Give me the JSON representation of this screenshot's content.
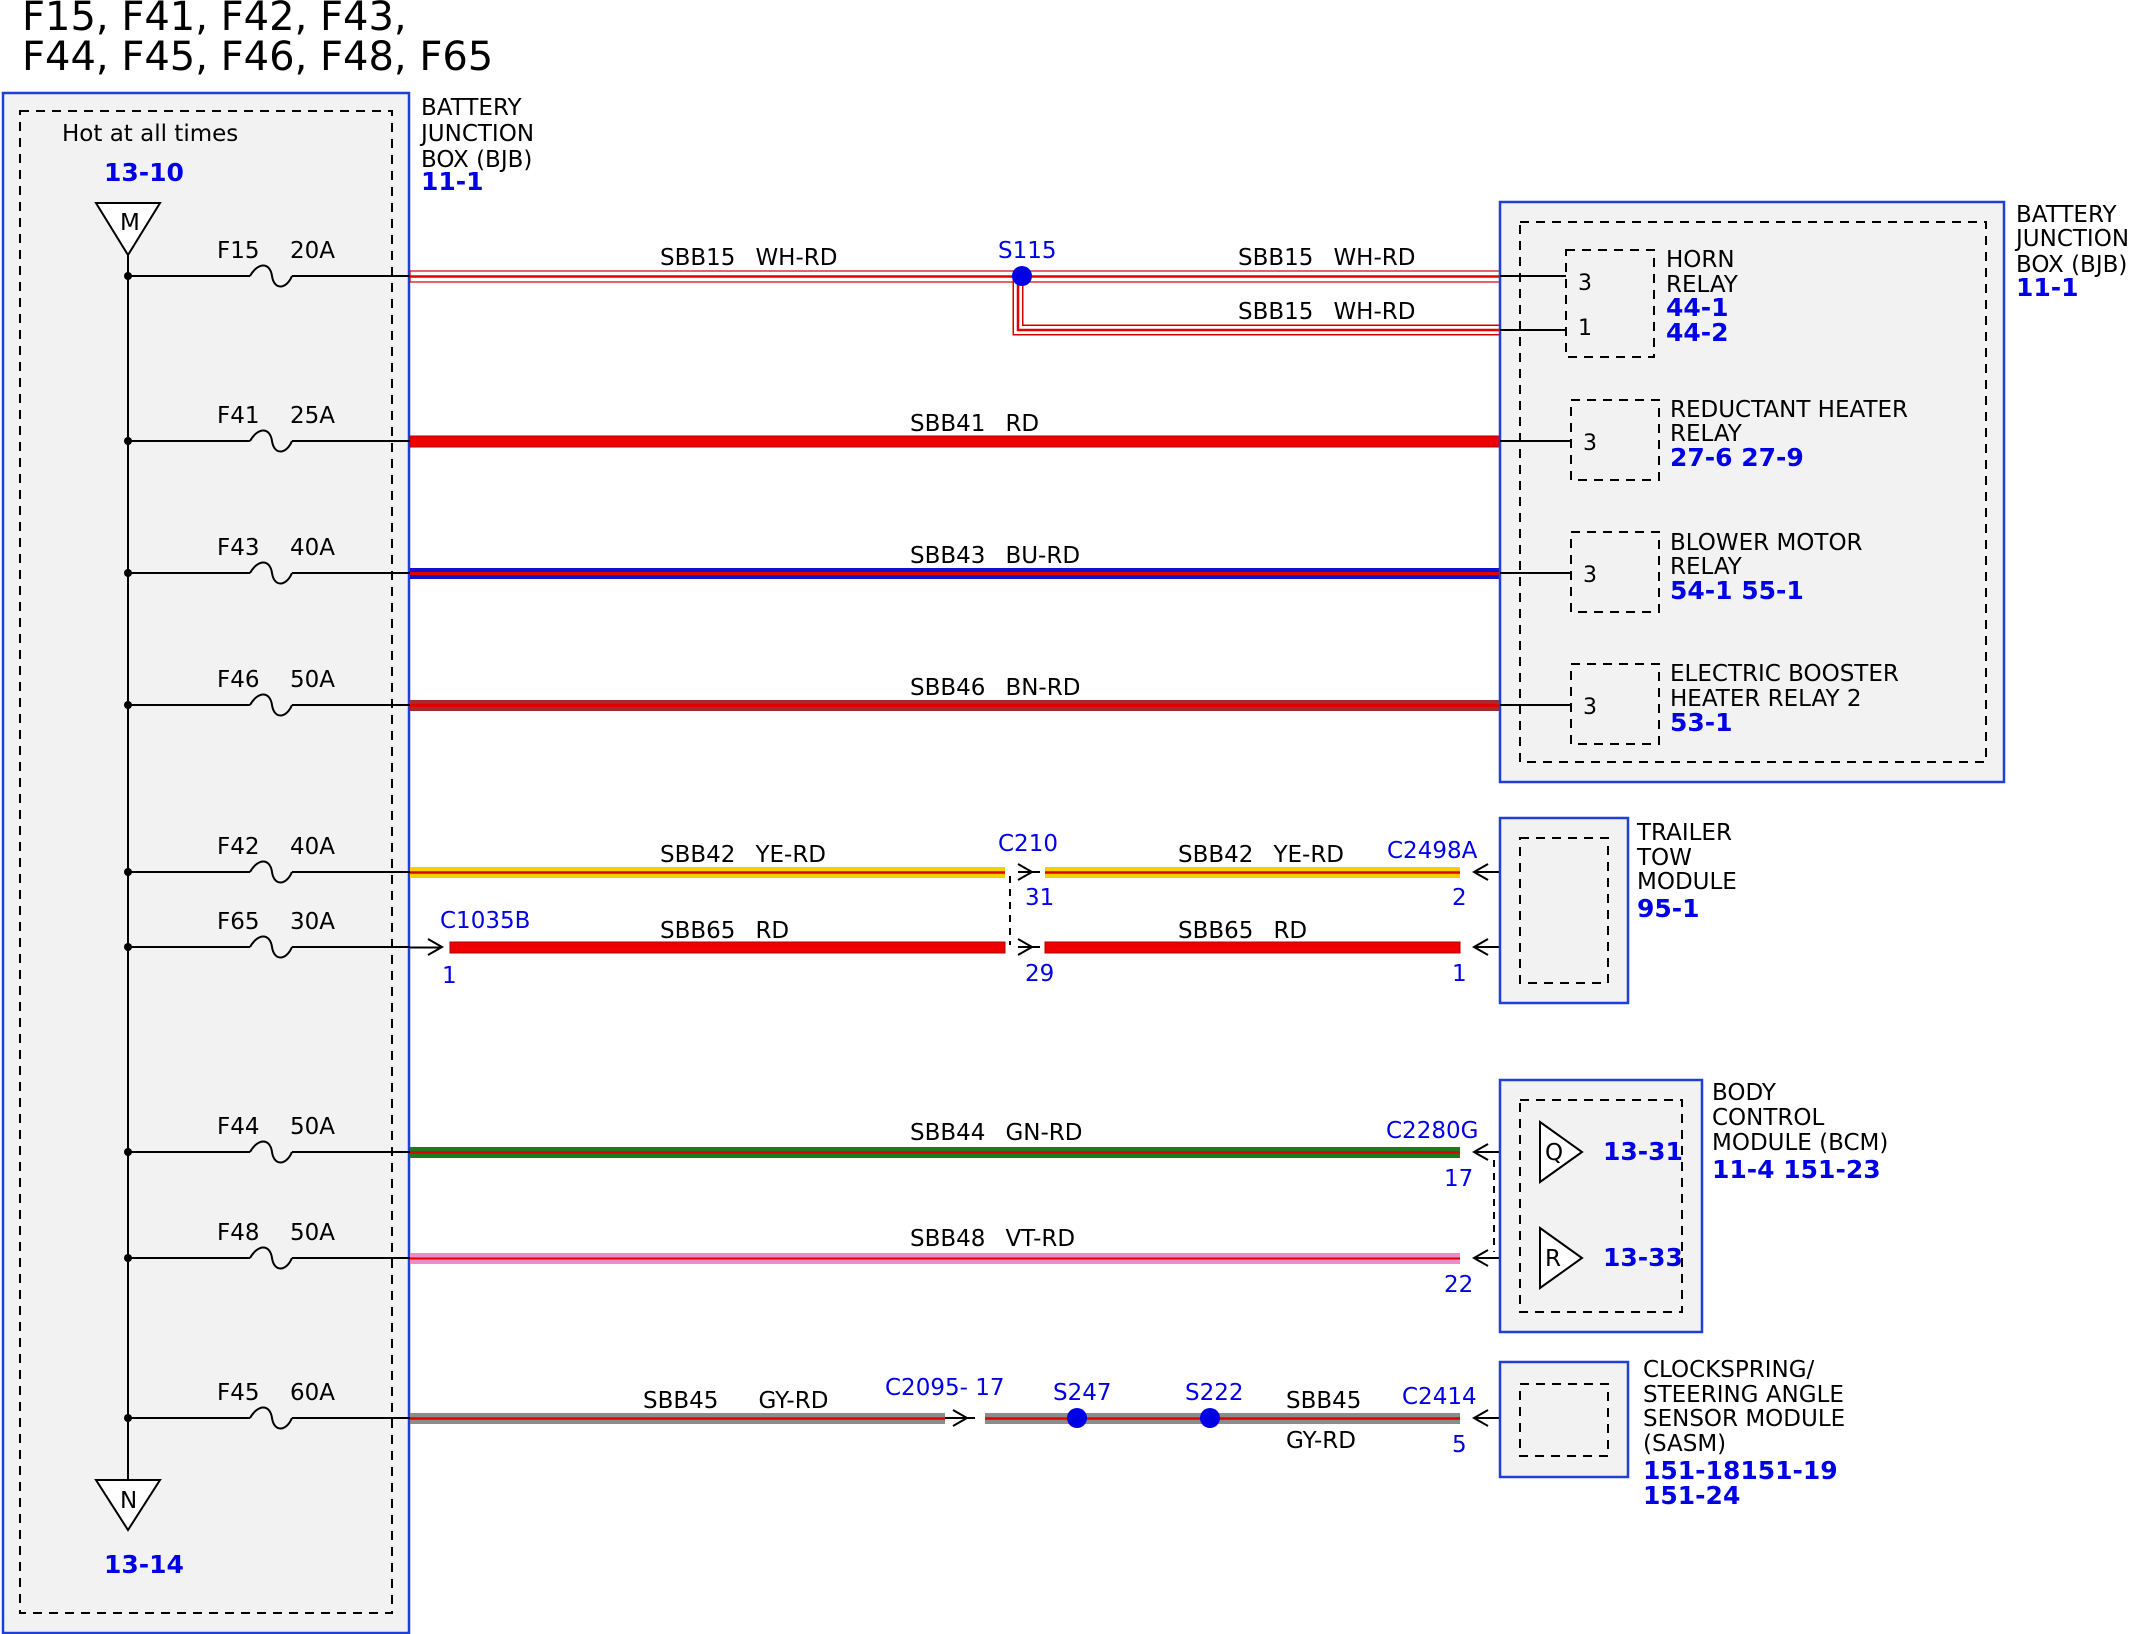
{
  "title": {
    "line1": "F15, F41, F42, F43,",
    "line2": "F44, F45, F46, F48, F65"
  },
  "colors": {
    "box_border": "#1f3fd6",
    "ref_blue": "#0000e6",
    "box_fill": "#f2f2f2"
  },
  "bjb_left": {
    "name_lines": [
      "BATTERY",
      "JUNCTION",
      "BOX (BJB)"
    ],
    "ref": "11-1",
    "hot_label": "Hot at all times",
    "top_ref": "13-10",
    "bottom_ref": "13-14",
    "m_label": "M",
    "n_label": "N"
  },
  "fuses": [
    {
      "name": "F15",
      "rating": "20A"
    },
    {
      "name": "F41",
      "rating": "25A"
    },
    {
      "name": "F43",
      "rating": "40A"
    },
    {
      "name": "F46",
      "rating": "50A"
    },
    {
      "name": "F42",
      "rating": "40A"
    },
    {
      "name": "F65",
      "rating": "30A"
    },
    {
      "name": "F44",
      "rating": "50A"
    },
    {
      "name": "F48",
      "rating": "50A"
    },
    {
      "name": "F45",
      "rating": "60A"
    }
  ],
  "wires": {
    "sbb15_a": {
      "circuit": "SBB15",
      "color": "WH-RD"
    },
    "sbb15_b": {
      "circuit": "SBB15",
      "color": "WH-RD"
    },
    "sbb15_c": {
      "circuit": "SBB15",
      "color": "WH-RD"
    },
    "sbb41": {
      "circuit": "SBB41",
      "color": "RD"
    },
    "sbb43": {
      "circuit": "SBB43",
      "color": "BU-RD"
    },
    "sbb46": {
      "circuit": "SBB46",
      "color": "BN-RD"
    },
    "sbb42_a": {
      "circuit": "SBB42",
      "color": "YE-RD"
    },
    "sbb42_b": {
      "circuit": "SBB42",
      "color": "YE-RD"
    },
    "sbb65_a": {
      "circuit": "SBB65",
      "color": "RD"
    },
    "sbb65_b": {
      "circuit": "SBB65",
      "color": "RD"
    },
    "sbb44": {
      "circuit": "SBB44",
      "color": "GN-RD"
    },
    "sbb48": {
      "circuit": "SBB48",
      "color": "VT-RD"
    },
    "sbb45_a": {
      "circuit": "SBB45",
      "color": "GY-RD"
    },
    "sbb45_b": {
      "circuit": "SBB45",
      "color": "GY-RD"
    }
  },
  "splices": {
    "s115": "S115",
    "s247": "S247",
    "s222": "S222"
  },
  "connectors": {
    "c210": "C210",
    "c210_pin1": "31",
    "c210_pin2": "29",
    "c2498a": "C2498A",
    "c2498a_pin1": "2",
    "c2498a_pin2": "1",
    "c1035b": "C1035B",
    "c1035b_pin": "1",
    "c2280g": "C2280G",
    "c2280g_pin1": "17",
    "c2280g_pin2": "22",
    "c2095": "C2095- 17",
    "c2414": "C2414",
    "c2414_pin": "5"
  },
  "bjb_right": {
    "name_lines": [
      "BATTERY",
      "JUNCTION",
      "BOX (BJB)"
    ],
    "ref": "11-1",
    "horn": {
      "lines": [
        "HORN",
        "RELAY"
      ],
      "refs": [
        "44-1",
        "44-2"
      ],
      "pin_top": "3",
      "pin_bottom": "1"
    },
    "reductant": {
      "lines": [
        "REDUCTANT HEATER",
        "RELAY"
      ],
      "refs": "27-6  27-9",
      "pin": "3"
    },
    "blower": {
      "lines": [
        "BLOWER MOTOR",
        "RELAY"
      ],
      "refs": "54-1  55-1",
      "pin": "3"
    },
    "booster": {
      "lines": [
        "ELECTRIC BOOSTER",
        "HEATER RELAY 2"
      ],
      "refs": "53-1",
      "pin": "3"
    }
  },
  "trailer": {
    "lines": [
      "TRAILER",
      "TOW",
      "MODULE"
    ],
    "ref": "95-1"
  },
  "bcm": {
    "lines": [
      "BODY",
      "CONTROL",
      "MODULE (BCM)"
    ],
    "refs": "11-4   151-23",
    "q_label": "Q",
    "q_ref": "13-31",
    "r_label": "R",
    "r_ref": "13-33"
  },
  "sasm": {
    "lines": [
      "CLOCKSPRING/",
      "STEERING ANGLE",
      "SENSOR MODULE",
      "(SASM)"
    ],
    "refs_line1": "151-18151-19",
    "refs_line2": "151-24"
  }
}
